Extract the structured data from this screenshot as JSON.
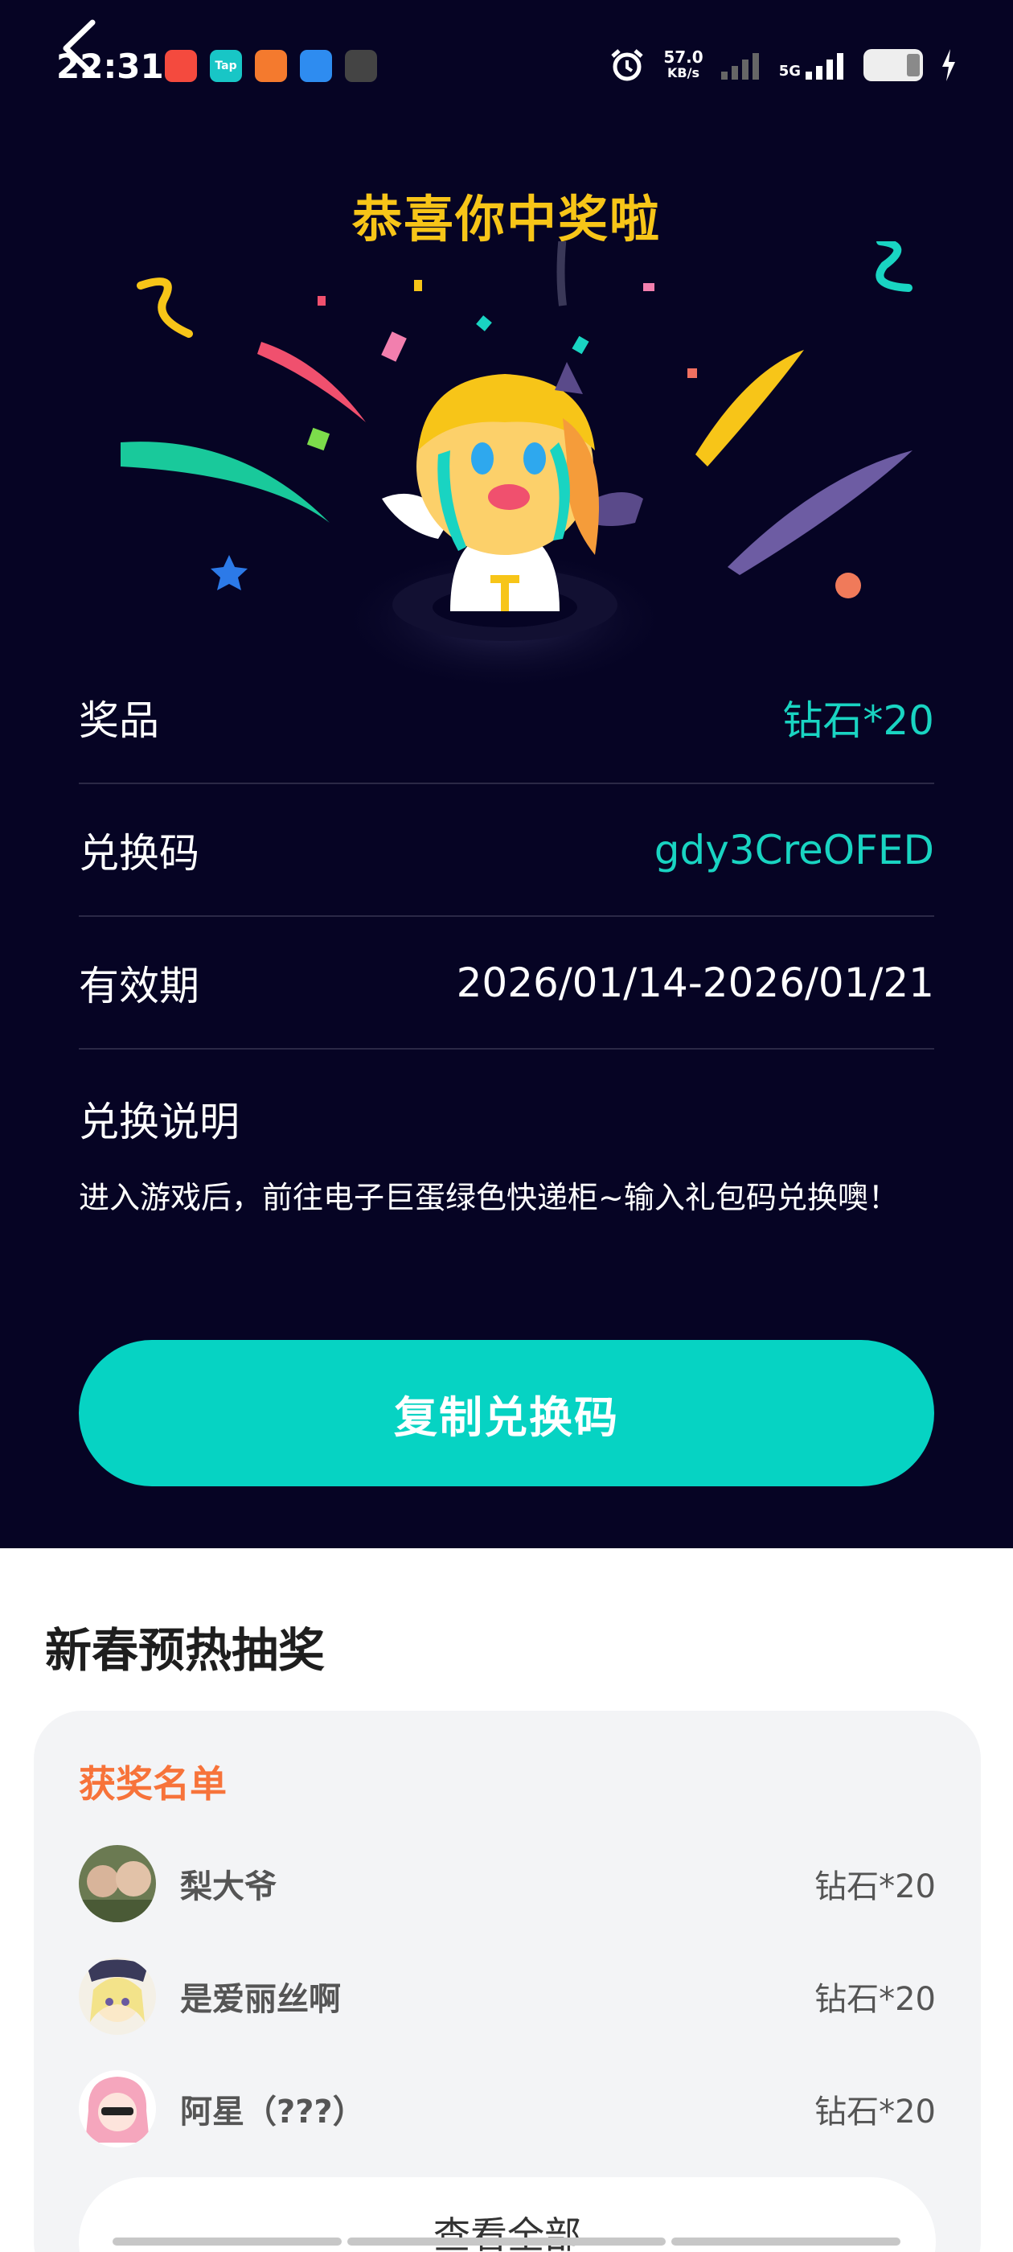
{
  "status_bar": {
    "time": "22:31",
    "app_icons": [
      {
        "name": "kuaishou-icon",
        "label": "",
        "color": "#f44a3e"
      },
      {
        "name": "taptap-icon",
        "label": "Tap",
        "color": "#18c6c6"
      },
      {
        "name": "kuaishou-icon",
        "label": "",
        "color": "#f47a2e"
      },
      {
        "name": "browser-icon",
        "label": "",
        "color": "#2e8cf0"
      },
      {
        "name": "app-icon",
        "label": "",
        "color": "#444444"
      }
    ],
    "network_speed": "57.0",
    "network_speed_unit": "KB/s",
    "network_type": "5G"
  },
  "headline": "恭喜你中奖啦",
  "prize_rows": [
    {
      "label": "奖品",
      "value": "钻石*20"
    },
    {
      "label": "兑换码",
      "value": "gdy3CreOFED"
    },
    {
      "label": "有效期",
      "value": "2026/01/14-2026/01/21"
    }
  ],
  "explanation": {
    "title": "兑换说明",
    "text": "进入游戏后，前往电子巨蛋绿色快递柜~输入礼包码兑换噢！"
  },
  "copy_button": "复制兑换码",
  "section_title": "新春预热抽奖",
  "winners": {
    "title": "获奖名单",
    "list": [
      {
        "name": "梨大爷",
        "prize": "钻石*20"
      },
      {
        "name": "是爱丽丝啊",
        "prize": "钻石*20"
      },
      {
        "name": "阿星（???）",
        "prize": "钻石*20"
      }
    ],
    "view_all": "查看全部"
  },
  "colors": {
    "background": "#060424",
    "accent": "#06d3c3",
    "headline": "#f7c518",
    "winners_title": "#f7733a"
  }
}
